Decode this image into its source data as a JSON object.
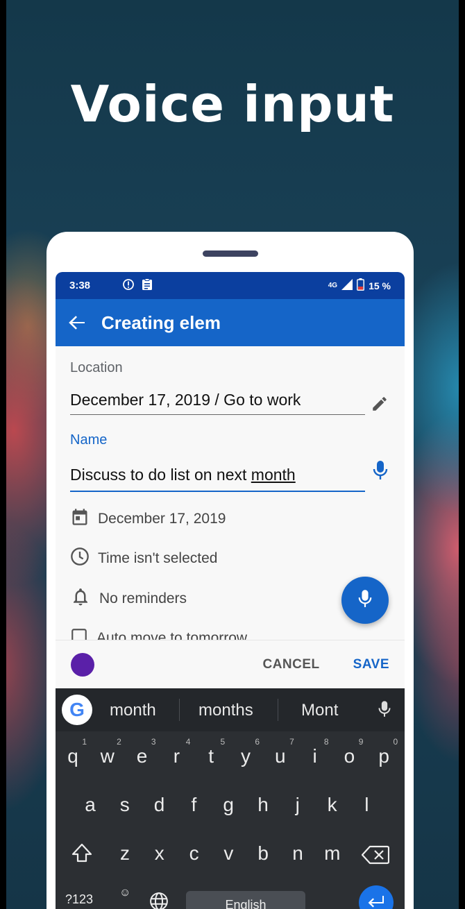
{
  "headline": "Voice input",
  "statusbar": {
    "time": "3:38",
    "network": "4G",
    "battery": "15 %"
  },
  "appbar": {
    "title": "Creating elem"
  },
  "form": {
    "location_label": "Location",
    "location_value": "December 17, 2019 / Go to work",
    "name_label": "Name",
    "name_value_prefix": "Discuss to do list on next ",
    "name_value_underlined": "month",
    "date_text": "December 17, 2019",
    "time_text": "Time isn't selected",
    "reminder_text": "No reminders",
    "auto_move_text": "Auto move to tomorrow"
  },
  "actions": {
    "cancel": "CANCEL",
    "save": "SAVE",
    "color": "#5a20a8"
  },
  "keyboard": {
    "suggestions": [
      "month",
      "months",
      "Mont"
    ],
    "row1": [
      "q",
      "w",
      "e",
      "r",
      "t",
      "y",
      "u",
      "i",
      "o",
      "p"
    ],
    "row1_hints": [
      "1",
      "2",
      "3",
      "4",
      "5",
      "6",
      "7",
      "8",
      "9",
      "0"
    ],
    "row2": [
      "a",
      "s",
      "d",
      "f",
      "g",
      "h",
      "j",
      "k",
      "l"
    ],
    "row3": [
      "z",
      "x",
      "c",
      "v",
      "b",
      "n",
      "m"
    ],
    "symbols": "?123",
    "emoji": "☺",
    "space": "English"
  },
  "colors": {
    "accent": "#1565c8",
    "statusbar": "#0b3f9f"
  }
}
